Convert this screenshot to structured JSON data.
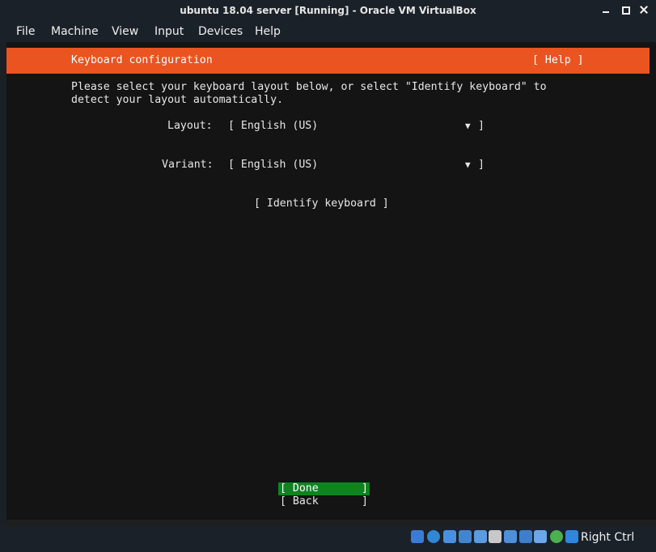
{
  "window": {
    "title": "ubuntu 18.04 server [Running] - Oracle VM VirtualBox"
  },
  "menu": [
    "File",
    "Machine",
    "View",
    "Input",
    "Devices",
    "Help"
  ],
  "installer": {
    "header_title": "Keyboard configuration",
    "help_label": "[ Help ]",
    "description_line1": "Please select your keyboard layout below, or select \"Identify keyboard\" to",
    "description_line2": "detect your layout automatically.",
    "layout_label": "Layout:",
    "layout_value": "[ English (US)",
    "variant_label": "Variant:",
    "variant_value": "[ English (US)",
    "dropdown_close": "]",
    "dropdown_arrow": "▼",
    "identify_button": "[ Identify keyboard ]",
    "done_open": "[ Done",
    "done_close": "]",
    "back_open": "[ Back",
    "back_close": "]"
  },
  "statusbar": {
    "host_key": "Right Ctrl",
    "icons": [
      "hard-disk-icon",
      "optical-drive-icon",
      "audio-icon",
      "network-icon",
      "usb-icon",
      "shared-folders-icon",
      "display-icon",
      "video-capture-icon",
      "virtualization-icon",
      "mouse-integration-icon",
      "keyboard-capture-icon"
    ]
  },
  "colors": {
    "header": "#e95420",
    "done_button": "#0e8420",
    "screen_bg": "#141414",
    "chrome_bg": "#1b2128"
  }
}
